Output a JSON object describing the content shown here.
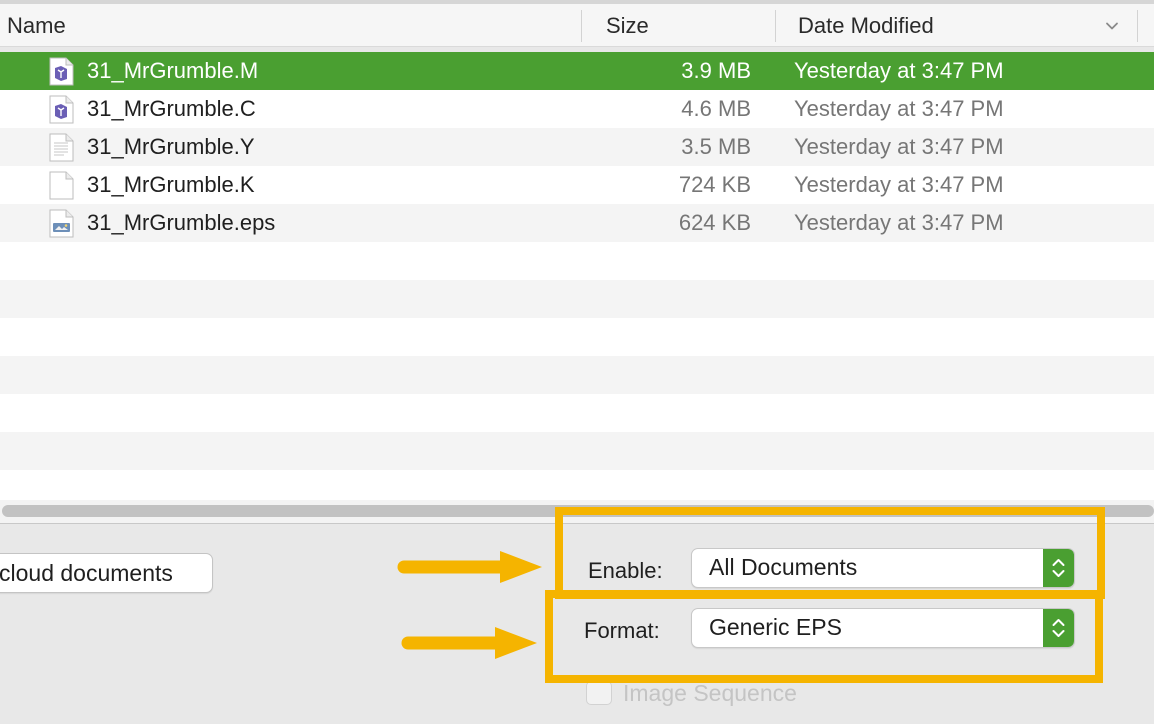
{
  "header": {
    "name_label": "Name",
    "size_label": "Size",
    "date_label": "Date Modified"
  },
  "files": [
    {
      "name": "31_MrGrumble.M",
      "size": "3.9 MB",
      "date": "Yesterday at 3:47 PM",
      "icon": "plate-document-icon",
      "selected": true
    },
    {
      "name": "31_MrGrumble.C",
      "size": "4.6 MB",
      "date": "Yesterday at 3:47 PM",
      "icon": "plate-document-icon",
      "selected": false
    },
    {
      "name": "31_MrGrumble.Y",
      "size": "3.5 MB",
      "date": "Yesterday at 3:47 PM",
      "icon": "text-document-icon",
      "selected": false
    },
    {
      "name": "31_MrGrumble.K",
      "size": "724 KB",
      "date": "Yesterday at 3:47 PM",
      "icon": "blank-document-icon",
      "selected": false
    },
    {
      "name": "31_MrGrumble.eps",
      "size": "624 KB",
      "date": "Yesterday at 3:47 PM",
      "icon": "eps-document-icon",
      "selected": false
    }
  ],
  "bottom": {
    "icloud_button": "cloud documents",
    "enable_label": "Enable:",
    "enable_value": "All Documents",
    "format_label": "Format:",
    "format_value": "Generic EPS",
    "image_sequence_label": "Image Sequence"
  },
  "colors": {
    "selection": "#4a9f31",
    "annotation": "#f5b400"
  }
}
